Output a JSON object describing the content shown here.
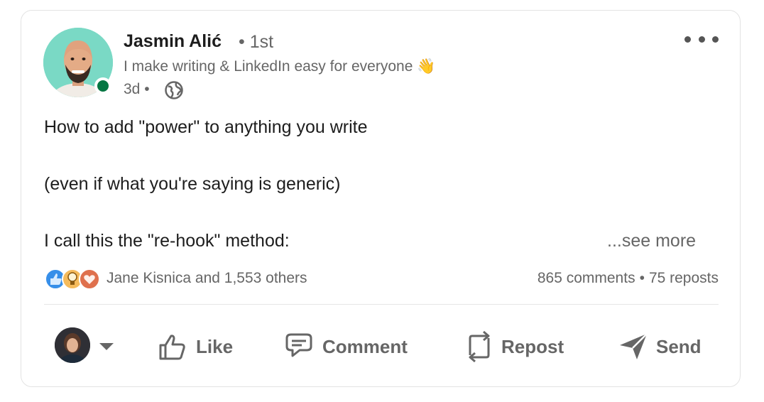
{
  "author": {
    "name": "Jasmin Alić",
    "degree": "• 1st",
    "headline": "I make writing & LinkedIn easy for everyone 👋",
    "age": "3d •"
  },
  "post": {
    "lines": [
      "How to add \"power\" to anything you write",
      "(even if what you're saying is generic)",
      "I call this the \"re-hook\" method:"
    ],
    "see_more": "...see more"
  },
  "social": {
    "reactions_text": "Jane Kisnica and 1,553 others",
    "comments": "865 comments",
    "separator": "•",
    "reposts": "75 reposts"
  },
  "actions": {
    "like": "Like",
    "comment": "Comment",
    "repost": "Repost",
    "send": "Send"
  },
  "colors": {
    "online": "#057642",
    "like_blue": "#378fe9",
    "insight_yellow": "#f5bb5c",
    "love_red": "#df704d",
    "muted_text": "#666666"
  }
}
